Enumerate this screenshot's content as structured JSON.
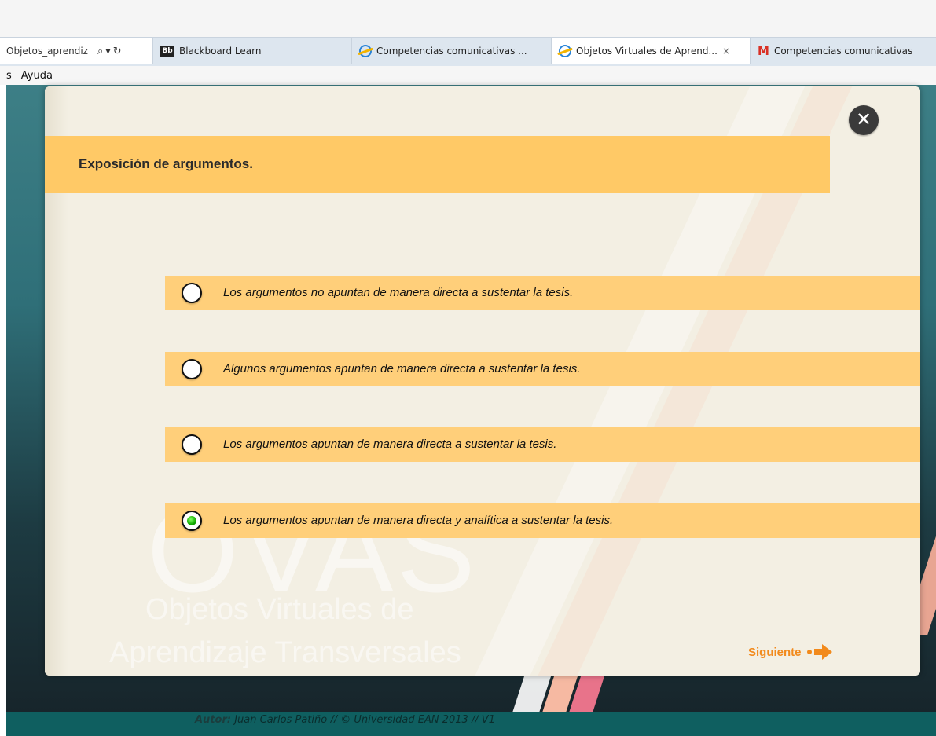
{
  "browser": {
    "address": "Objetos_aprendiz",
    "tabs": [
      {
        "label": "Blackboard Learn",
        "icon": "blackboard-icon"
      },
      {
        "label": "Competencias comunicativas ...",
        "icon": "ie-icon"
      },
      {
        "label": "Objetos Virtuales de Aprend...",
        "icon": "ie-icon",
        "active": true,
        "close": "×"
      },
      {
        "label": "Competencias comunicativas",
        "icon": "gmail-icon"
      }
    ],
    "bb_badge": "Bb",
    "gmail_glyph": "M",
    "menu": [
      "s",
      "Ayuda"
    ]
  },
  "quiz": {
    "title": "Exposición de argumentos.",
    "close_glyph": "✕",
    "options": [
      {
        "text": "Los argumentos no apuntan de manera directa a sustentar la tesis.",
        "selected": false
      },
      {
        "text": "Algunos argumentos apuntan de manera directa a sustentar la tesis.",
        "selected": false
      },
      {
        "text": "Los argumentos apuntan de manera directa a sustentar la tesis.",
        "selected": false
      },
      {
        "text": "Los argumentos apuntan de manera directa y analítica a sustentar la tesis.",
        "selected": true
      }
    ],
    "next_label": "Siguiente"
  },
  "watermark": {
    "big": "OVAS",
    "line1": "Objetos Virtuales de",
    "line2": "Aprendizaje Transversales"
  },
  "footer": {
    "author_label": "Autor:",
    "author_text": " Juan Carlos Patiño // © Universidad EAN 2013 // V1"
  },
  "colors": {
    "accent_orange": "#f28a1c",
    "title_bar": "#ffc966",
    "option_bar": "#ffcf7a",
    "selected_radio": "#11a900"
  }
}
